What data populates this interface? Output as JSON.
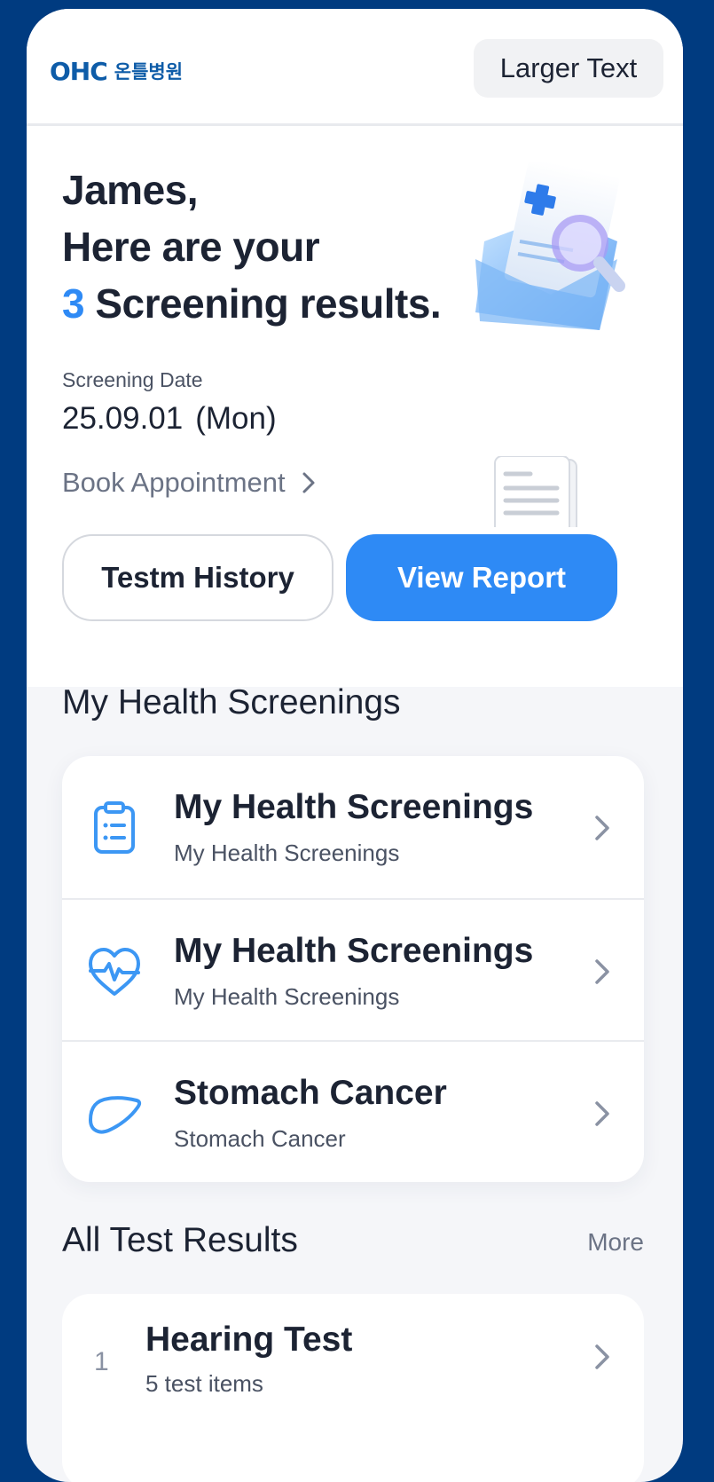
{
  "header": {
    "logo_mark": "OHC",
    "logo_text": "온틀병원",
    "larger_text_label": "Larger Text"
  },
  "hero": {
    "greeting_name": "James,",
    "greeting_line2": "Here are your",
    "result_count": "3",
    "greeting_line3_rest": " Screening results.",
    "date_label": "Screening Date",
    "date_value": "25.09.01",
    "date_day": "(Mon)",
    "book_label": "Book Appointment",
    "history_button": "Testm History",
    "report_button": "View Report"
  },
  "screenings": {
    "section_title": "My Health Screenings",
    "items": [
      {
        "title": "My Health Screenings",
        "subtitle": "My Health Screenings",
        "icon": "clipboard-icon"
      },
      {
        "title": "My Health Screenings",
        "subtitle": "My Health Screenings",
        "icon": "heart-pulse-icon"
      },
      {
        "title": "Stomach Cancer",
        "subtitle": "Stomach Cancer",
        "icon": "liver-icon"
      }
    ]
  },
  "results": {
    "section_title": "All Test Results",
    "more_label": "More",
    "items": [
      {
        "index": "1",
        "title": "Hearing Test",
        "subtitle": "5 test items"
      }
    ]
  },
  "colors": {
    "background": "#003B80",
    "accent": "#2E8AF5",
    "brand": "#0E5CA8"
  }
}
